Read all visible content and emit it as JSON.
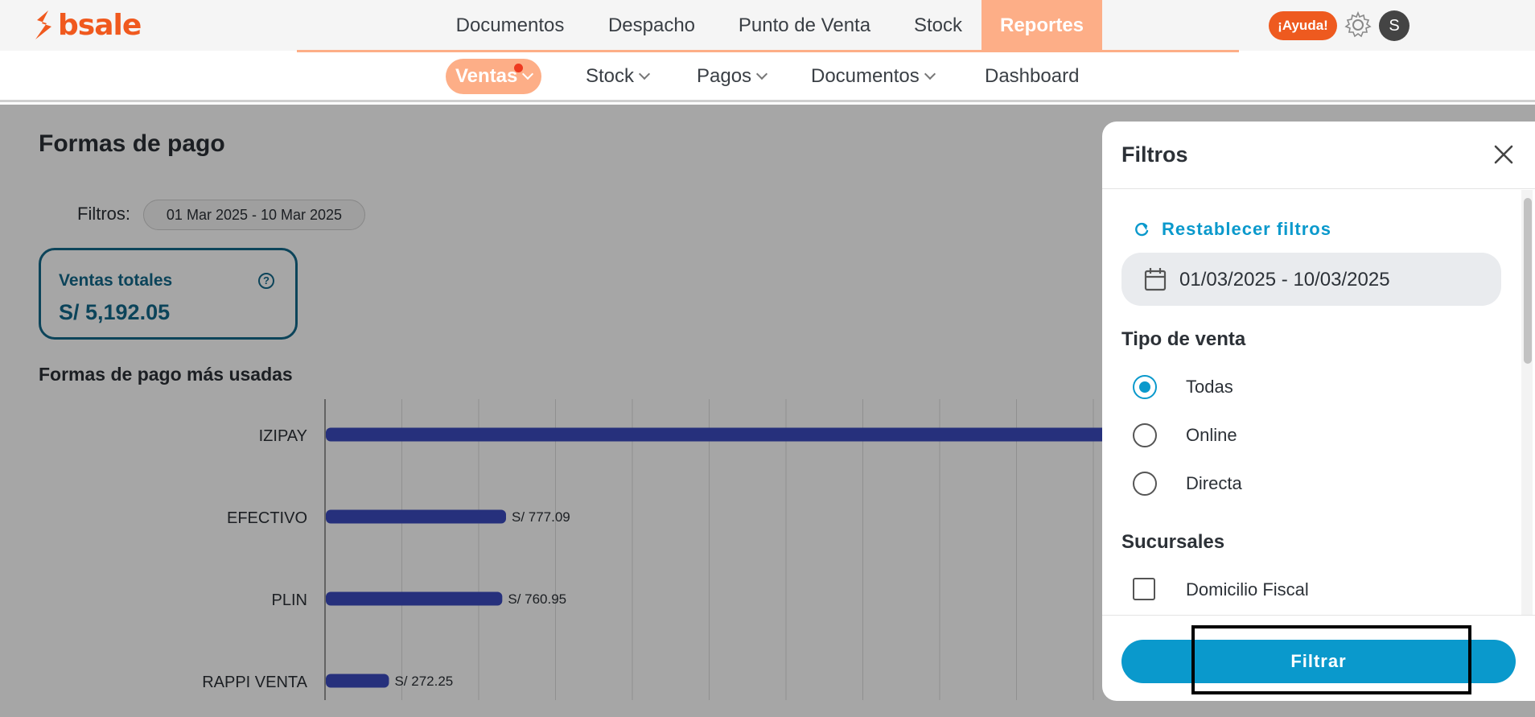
{
  "brand": {
    "name": "bsale",
    "color": "#f0591e"
  },
  "main_nav": {
    "items": [
      {
        "label": "Documentos",
        "active": false
      },
      {
        "label": "Despacho",
        "active": false
      },
      {
        "label": "Punto de Venta",
        "active": false
      },
      {
        "label": "Stock",
        "active": false
      },
      {
        "label": "Reportes",
        "active": true
      }
    ],
    "help_label": "¡Ayuda!",
    "avatar_initial": "S"
  },
  "sub_nav": {
    "items": [
      {
        "label": "Ventas",
        "active": true,
        "has_dropdown": true,
        "notification": true
      },
      {
        "label": "Stock",
        "active": false,
        "has_dropdown": true
      },
      {
        "label": "Pagos",
        "active": false,
        "has_dropdown": true
      },
      {
        "label": "Documentos",
        "active": false,
        "has_dropdown": true
      },
      {
        "label": "Dashboard",
        "active": false,
        "has_dropdown": false
      }
    ]
  },
  "page": {
    "title": "Formas de pago",
    "filters_label": "Filtros:",
    "date_range_chip": "01 Mar 2025 - 10 Mar 2025",
    "kpi": {
      "label": "Ventas totales",
      "value": "S/ 5,192.05",
      "help_icon": "question-circle-icon"
    },
    "chart_title": "Formas de pago más usadas"
  },
  "chart_data": {
    "type": "bar",
    "orientation": "horizontal",
    "title": "Formas de pago más usadas",
    "categories": [
      "IZIPAY",
      "EFECTIVO",
      "PLIN",
      "RAPPI VENTA"
    ],
    "values": [
      3381.76,
      777.09,
      760.95,
      272.25
    ],
    "value_labels": [
      "",
      "S/ 777.09",
      "S/ 760.95",
      "S/ 272.25"
    ],
    "grid": true,
    "bar_color": "#3b4bbf"
  },
  "drawer": {
    "title": "Filtros",
    "reset_label": "Restablecer filtros",
    "date_value": "01/03/2025 - 10/03/2025",
    "sale_type": {
      "title": "Tipo de venta",
      "options": [
        {
          "label": "Todas",
          "checked": true
        },
        {
          "label": "Online",
          "checked": false
        },
        {
          "label": "Directa",
          "checked": false
        }
      ]
    },
    "branches": {
      "title": "Sucursales",
      "options": [
        {
          "label": "Domicilio Fiscal",
          "checked": false
        }
      ]
    },
    "submit_label": "Filtrar"
  }
}
